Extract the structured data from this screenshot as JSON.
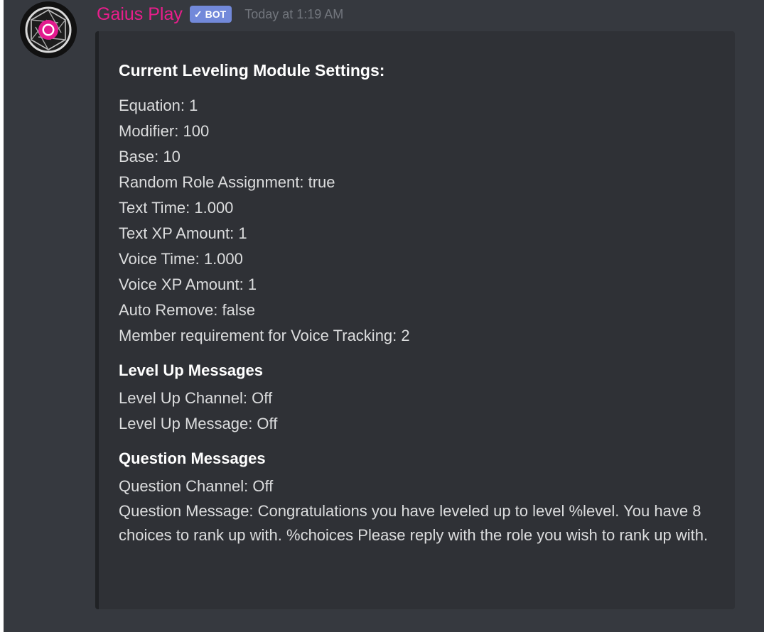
{
  "author": {
    "name": "Gaius Play",
    "bot_badge": "BOT",
    "timestamp": "Today at 1:19 AM",
    "name_color": "#e91e8c",
    "avatar_icon": "camera-aperture-icon"
  },
  "embed": {
    "title": "Current Leveling Module Settings:",
    "settings": [
      "Equation: 1",
      "Modifier: 100",
      "Base: 10",
      "Random Role Assignment: true",
      "Text Time: 1.000",
      "Text XP Amount: 1",
      "Voice Time: 1.000",
      "Voice XP Amount: 1",
      "Auto Remove: false",
      "Member requirement for Voice Tracking: 2"
    ],
    "level_up": {
      "title": "Level Up Messages",
      "lines": [
        "Level Up Channel: Off",
        "Level Up Message: Off"
      ]
    },
    "question": {
      "title": "Question Messages",
      "channel": "Question Channel: Off",
      "message": "Question Message: Congratulations you have leveled up to level %level. You have 8 choices to rank up with. %choices Please reply with the role you wish to rank up with."
    }
  },
  "colors": {
    "background": "#36393f",
    "embed_background": "#2f3136",
    "bot_badge": "#7289da",
    "text": "#dcddde",
    "timestamp": "#72767d"
  }
}
